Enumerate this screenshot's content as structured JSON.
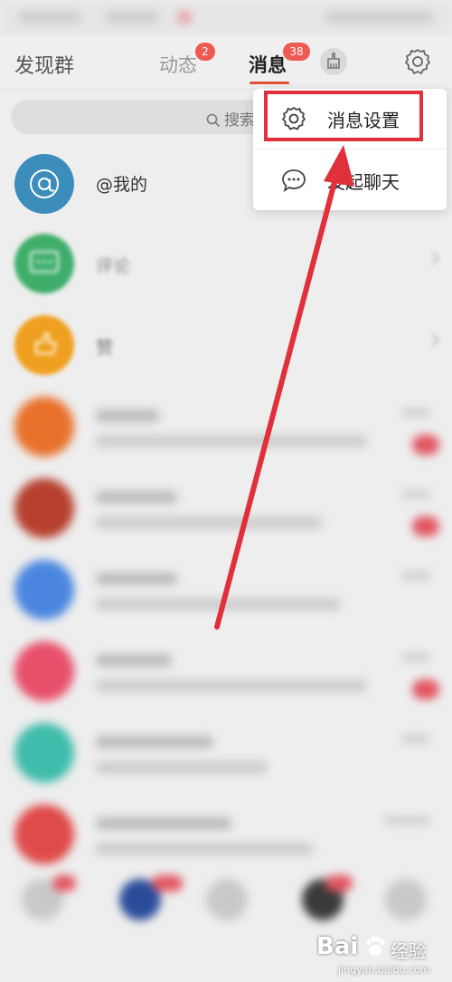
{
  "topnav": {
    "title": "发现群",
    "tabs": [
      {
        "label": "动态",
        "badge": "2"
      },
      {
        "label": "消息",
        "badge": "38"
      }
    ]
  },
  "search": {
    "label": "搜索"
  },
  "rows": [
    {
      "title": "@我的"
    },
    {
      "title": "评论"
    },
    {
      "title": "赞"
    }
  ],
  "popup": {
    "items": [
      {
        "label": "消息设置",
        "icon": "gear-icon"
      },
      {
        "label": "发起聊天",
        "icon": "chat-bubble-icon"
      }
    ]
  },
  "watermark": {
    "brand": "Bai",
    "brand2": "经验",
    "url": "jingyan.baidu.com"
  },
  "colors": {
    "accent": "#e25038",
    "badge": "#ee5a52",
    "annotation": "#e0303c"
  }
}
